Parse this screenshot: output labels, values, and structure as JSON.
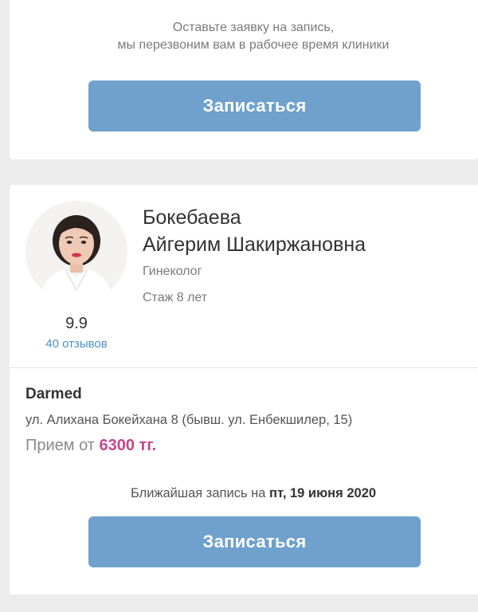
{
  "top_card": {
    "note_line1": "Оставьте заявку на запись,",
    "note_line2": "мы перезвоним вам в рабочее время клиники",
    "button_label": "Записаться"
  },
  "doctor": {
    "last_name": "Бокебаева",
    "first_middle": "Айгерим Шакиржановна",
    "specialty": "Гинеколог",
    "experience": "Стаж 8 лет",
    "rating": "9.9",
    "reviews": "40 отзывов",
    "clinic": "Darmed",
    "address": "ул. Алихана Бокейхана 8 (бывш. ул. Енбекшилер, 15)",
    "price_prefix": "Прием от ",
    "price_amount": "6300 тг.",
    "nearest_prefix": "Ближайшая запись на ",
    "nearest_date": "пт, 19 июня 2020",
    "button_label": "Записаться"
  },
  "colors": {
    "button": "#6fa1cc",
    "price": "#c2478c",
    "link": "#4a8fc6"
  }
}
